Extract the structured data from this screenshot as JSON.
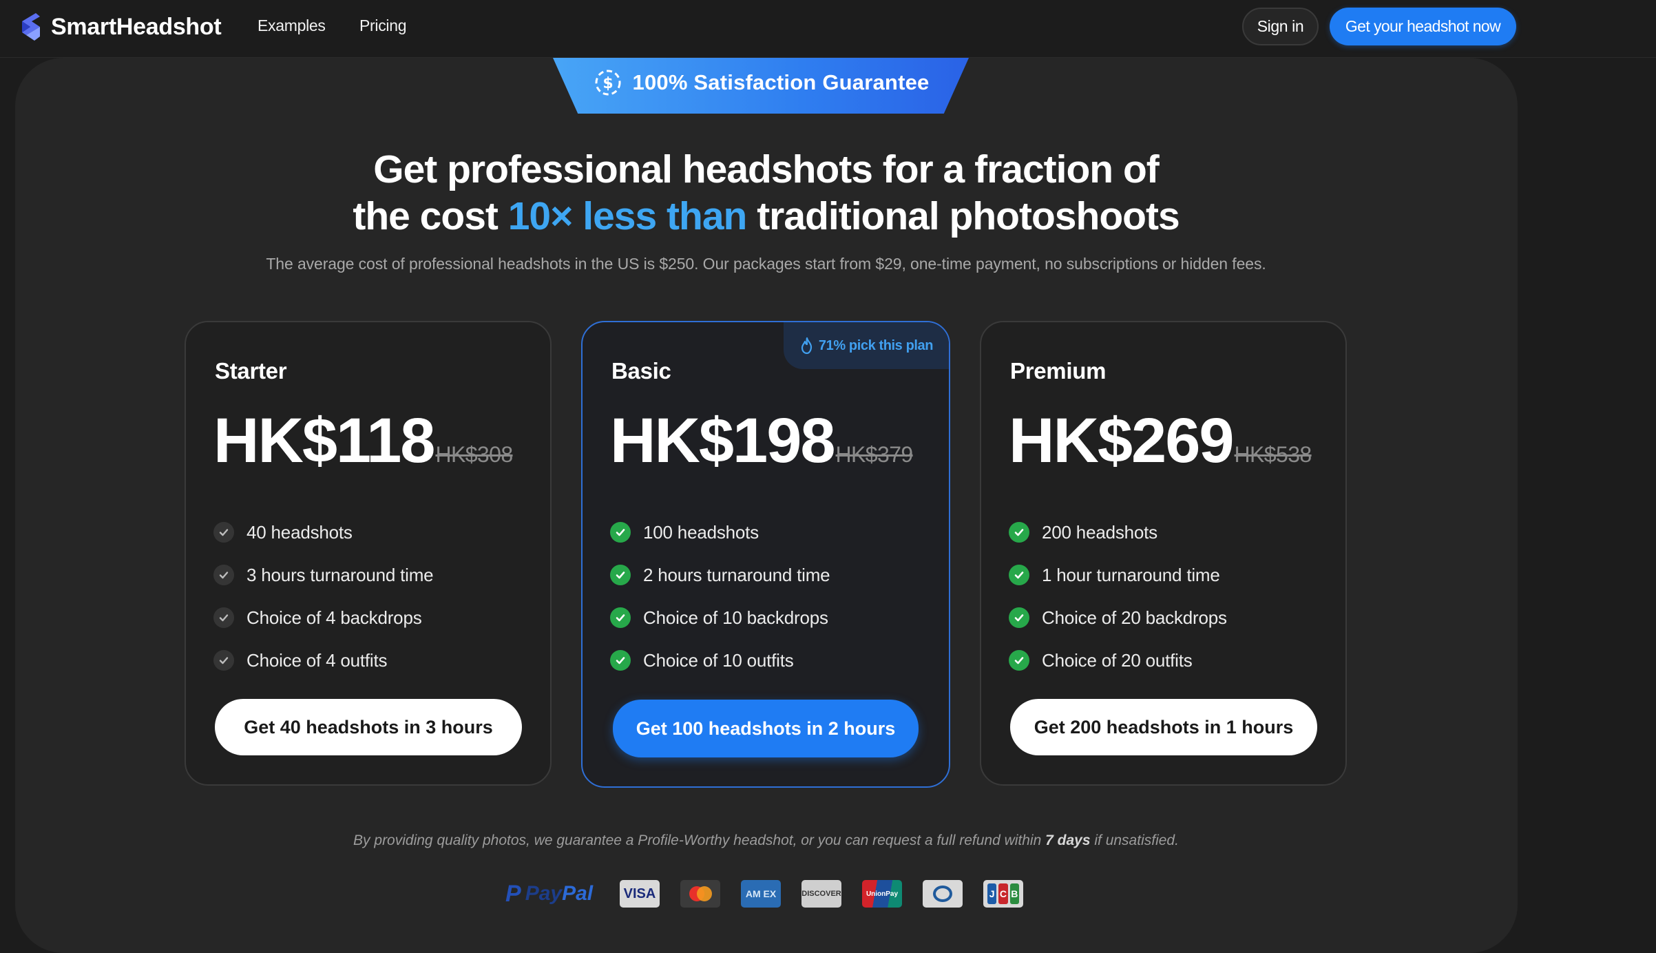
{
  "nav": {
    "brand": "SmartHeadshot",
    "links": [
      "Examples",
      "Pricing"
    ],
    "signin_label": "Sign in",
    "cta_label": "Get your headshot now"
  },
  "hero": {
    "badge": "100% Satisfaction Guarantee",
    "headline_line1": "Get professional headshots for a fraction of",
    "headline_line2_pre": "the cost",
    "headline_accent": "10× less than",
    "headline_line2_post": "traditional photoshoots",
    "subline": "The average cost of professional headshots in the US is $250. Our packages start from $29, one-time payment, no subscriptions or hidden fees."
  },
  "plans": [
    {
      "name": "Starter",
      "price": "HK$118",
      "old_price": "HK$308",
      "features": [
        "40 headshots",
        "3 hours turnaround time",
        "Choice of 4 backdrops",
        "Choice of 4 outfits"
      ],
      "button": "Get 40 headshots in 3 hours"
    },
    {
      "name": "Basic",
      "badge": "71% pick this plan",
      "price": "HK$198",
      "old_price": "HK$379",
      "features": [
        "100 headshots",
        "2 hours turnaround time",
        "Choice of 10 backdrops",
        "Choice of 10 outfits"
      ],
      "button": "Get 100 headshots in 2 hours"
    },
    {
      "name": "Premium",
      "price": "HK$269",
      "old_price": "HK$538",
      "features": [
        "200 headshots",
        "1 hour turnaround time",
        "Choice of 20 backdrops",
        "Choice of 20 outfits"
      ],
      "button": "Get 200 headshots in 1 hours"
    }
  ],
  "refund": {
    "pre": "By providing quality photos, we guarantee a Profile-Worthy headshot, or you can request a full refund within",
    "bold": "7 days",
    "post": "if unsatisfied."
  },
  "payments": {
    "paypal_pay": "Pay",
    "paypal_pal": "Pal",
    "visa": "VISA",
    "amex": "AM EX",
    "discover": "DISCOVER",
    "unionpay": "UnionPay",
    "jcb": [
      "J",
      "C",
      "B"
    ],
    "icons": [
      "paypal-icon",
      "visa-icon",
      "mastercard-icon",
      "amex-icon",
      "discover-icon",
      "unionpay-icon",
      "diners-club-icon",
      "jcb-icon"
    ]
  },
  "colors": {
    "accent_blue": "#1f7cf3",
    "headline_accent": "#3ea6f2",
    "check_green": "#27a84a",
    "background": "#1c1c1c",
    "panel": "#262626"
  }
}
